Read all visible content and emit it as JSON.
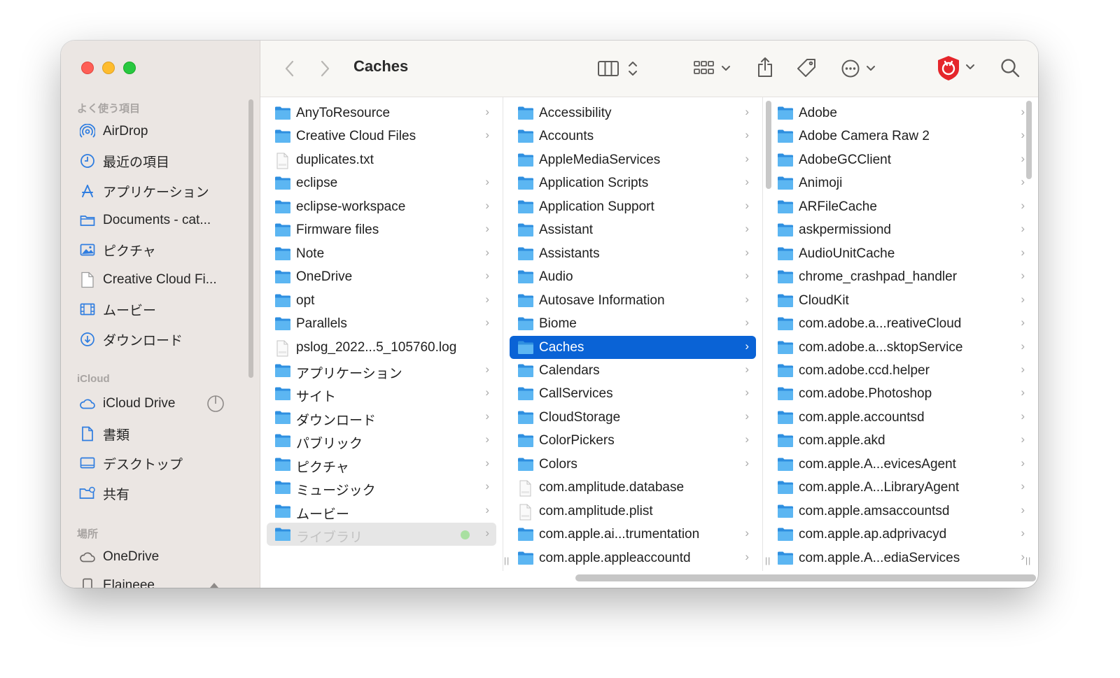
{
  "window": {
    "title": "Caches"
  },
  "sidebar": {
    "sections": [
      {
        "title": "よく使う項目",
        "items": [
          {
            "label": "AirDrop",
            "icon": "airdrop-icon"
          },
          {
            "label": "最近の項目",
            "icon": "clock-icon"
          },
          {
            "label": "アプリケーション",
            "icon": "applications-icon"
          },
          {
            "label": "Documents - cat...",
            "icon": "folder-icon"
          },
          {
            "label": "ピクチャ",
            "icon": "photo-icon"
          },
          {
            "label": "Creative Cloud Fi...",
            "icon": "document-icon"
          },
          {
            "label": "ムービー",
            "icon": "film-icon"
          },
          {
            "label": "ダウンロード",
            "icon": "download-icon"
          }
        ]
      },
      {
        "title": "iCloud",
        "items": [
          {
            "label": "iCloud Drive",
            "icon": "cloud-icon"
          },
          {
            "label": "書類",
            "icon": "document-icon"
          },
          {
            "label": "デスクトップ",
            "icon": "desktop-icon"
          },
          {
            "label": "共有",
            "icon": "shared-folder-icon"
          }
        ]
      },
      {
        "title": "場所",
        "items": [
          {
            "label": "OneDrive",
            "icon": "cloud-icon"
          },
          {
            "label": "Elaineee",
            "icon": "drive-icon"
          }
        ]
      }
    ]
  },
  "toolbar": {
    "back_icon": "chevron-left-icon",
    "forward_icon": "chevron-right-icon",
    "view_icon": "column-view-icon",
    "group_icon": "grid-icon",
    "share_icon": "share-icon",
    "tag_icon": "tag-icon",
    "more_icon": "ellipsis-circle-icon",
    "extension_icon": "shield-extension-icon",
    "search_icon": "search-icon",
    "colors": {
      "extension": "#e5262b",
      "selection": "#0a63d6",
      "folder": "#39a2ec"
    }
  },
  "columns": [
    {
      "items": [
        {
          "label": "AnyToResource",
          "type": "folder",
          "chevron": true
        },
        {
          "label": "Creative Cloud Files",
          "type": "folder",
          "chevron": true
        },
        {
          "label": "duplicates.txt",
          "type": "file",
          "chevron": false
        },
        {
          "label": "eclipse",
          "type": "folder",
          "chevron": true
        },
        {
          "label": "eclipse-workspace",
          "type": "folder",
          "chevron": true
        },
        {
          "label": "Firmware files",
          "type": "folder",
          "chevron": true
        },
        {
          "label": "Note",
          "type": "folder",
          "chevron": true
        },
        {
          "label": "OneDrive",
          "type": "folder",
          "chevron": true
        },
        {
          "label": "opt",
          "type": "folder",
          "chevron": true
        },
        {
          "label": "Parallels",
          "type": "folder",
          "chevron": true
        },
        {
          "label": "pslog_2022...5_105760.log",
          "type": "file",
          "chevron": false
        },
        {
          "label": "アプリケーション",
          "type": "folder",
          "chevron": true
        },
        {
          "label": "サイト",
          "type": "folder",
          "chevron": true
        },
        {
          "label": "ダウンロード",
          "type": "folder",
          "chevron": true
        },
        {
          "label": "パブリック",
          "type": "folder",
          "chevron": true
        },
        {
          "label": "ピクチャ",
          "type": "folder",
          "chevron": true
        },
        {
          "label": "ミュージック",
          "type": "folder",
          "chevron": true
        },
        {
          "label": "ムービー",
          "type": "folder",
          "chevron": true
        },
        {
          "label": "ライブラリ",
          "type": "folder",
          "chevron": true,
          "state": "dim",
          "tag": "green"
        }
      ]
    },
    {
      "items": [
        {
          "label": "Accessibility",
          "type": "folder",
          "chevron": true
        },
        {
          "label": "Accounts",
          "type": "folder",
          "chevron": true
        },
        {
          "label": "AppleMediaServices",
          "type": "folder",
          "chevron": true
        },
        {
          "label": "Application Scripts",
          "type": "folder",
          "chevron": true
        },
        {
          "label": "Application Support",
          "type": "folder",
          "chevron": true
        },
        {
          "label": "Assistant",
          "type": "folder",
          "chevron": true
        },
        {
          "label": "Assistants",
          "type": "folder",
          "chevron": true
        },
        {
          "label": "Audio",
          "type": "folder",
          "chevron": true
        },
        {
          "label": "Autosave Information",
          "type": "folder",
          "chevron": true
        },
        {
          "label": "Biome",
          "type": "folder",
          "chevron": true
        },
        {
          "label": "Caches",
          "type": "folder",
          "chevron": true,
          "state": "selected"
        },
        {
          "label": "Calendars",
          "type": "folder",
          "chevron": true
        },
        {
          "label": "CallServices",
          "type": "folder",
          "chevron": true
        },
        {
          "label": "CloudStorage",
          "type": "folder",
          "chevron": true
        },
        {
          "label": "ColorPickers",
          "type": "folder",
          "chevron": true
        },
        {
          "label": "Colors",
          "type": "folder",
          "chevron": true
        },
        {
          "label": "com.amplitude.database",
          "type": "file",
          "chevron": false
        },
        {
          "label": "com.amplitude.plist",
          "type": "file",
          "chevron": false
        },
        {
          "label": "com.apple.ai...trumentation",
          "type": "folder",
          "chevron": true
        },
        {
          "label": "com.apple.appleaccountd",
          "type": "folder",
          "chevron": true
        }
      ]
    },
    {
      "items": [
        {
          "label": "Adobe",
          "type": "folder",
          "chevron": true
        },
        {
          "label": "Adobe Camera Raw 2",
          "type": "folder",
          "chevron": true
        },
        {
          "label": "AdobeGCClient",
          "type": "folder",
          "chevron": true
        },
        {
          "label": "Animoji",
          "type": "folder",
          "chevron": true
        },
        {
          "label": "ARFileCache",
          "type": "folder",
          "chevron": true
        },
        {
          "label": "askpermissiond",
          "type": "folder",
          "chevron": true
        },
        {
          "label": "AudioUnitCache",
          "type": "folder",
          "chevron": true
        },
        {
          "label": "chrome_crashpad_handler",
          "type": "folder",
          "chevron": true
        },
        {
          "label": "CloudKit",
          "type": "folder",
          "chevron": true
        },
        {
          "label": "com.adobe.a...reativeCloud",
          "type": "folder",
          "chevron": true
        },
        {
          "label": "com.adobe.a...sktopService",
          "type": "folder",
          "chevron": true
        },
        {
          "label": "com.adobe.ccd.helper",
          "type": "folder",
          "chevron": true
        },
        {
          "label": "com.adobe.Photoshop",
          "type": "folder",
          "chevron": true
        },
        {
          "label": "com.apple.accountsd",
          "type": "folder",
          "chevron": true
        },
        {
          "label": "com.apple.akd",
          "type": "folder",
          "chevron": true
        },
        {
          "label": "com.apple.A...evicesAgent",
          "type": "folder",
          "chevron": true
        },
        {
          "label": "com.apple.A...LibraryAgent",
          "type": "folder",
          "chevron": true
        },
        {
          "label": "com.apple.amsaccountsd",
          "type": "folder",
          "chevron": true
        },
        {
          "label": "com.apple.ap.adprivacyd",
          "type": "folder",
          "chevron": true
        },
        {
          "label": "com.apple.A...ediaServices",
          "type": "folder",
          "chevron": true
        }
      ]
    }
  ]
}
